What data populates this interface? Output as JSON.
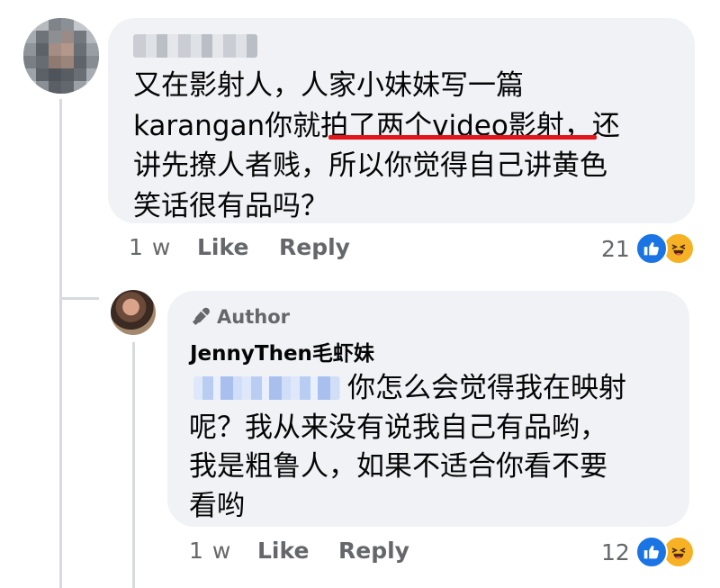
{
  "comment": {
    "text": "又在影射人，人家小妹妹写一篇\nkarangan你就拍了两个video影射，还\n讲先撩人者贱，所以你觉得自己讲黄色\n笑话很有品吗？",
    "time": "1 w",
    "like_label": "Like",
    "reply_label": "Reply",
    "reaction_count": "21"
  },
  "reply": {
    "author_badge": "Author",
    "author_name": "JennyThen毛虾妹",
    "text": "你怎么会觉得我在映射\n呢？我从来没有说我自己有品哟，\n我是粗鲁人，如果不适合你看不要\n看哟",
    "time": "1 w",
    "like_label": "Like",
    "reply_label": "Reply",
    "reaction_count": "12"
  },
  "colors": {
    "bubble": "#f0f2f5",
    "meta_text": "#65676b",
    "like_blue": "#1b74e4",
    "haha_yellow": "#f7b125",
    "underline_red": "#e3161b"
  }
}
